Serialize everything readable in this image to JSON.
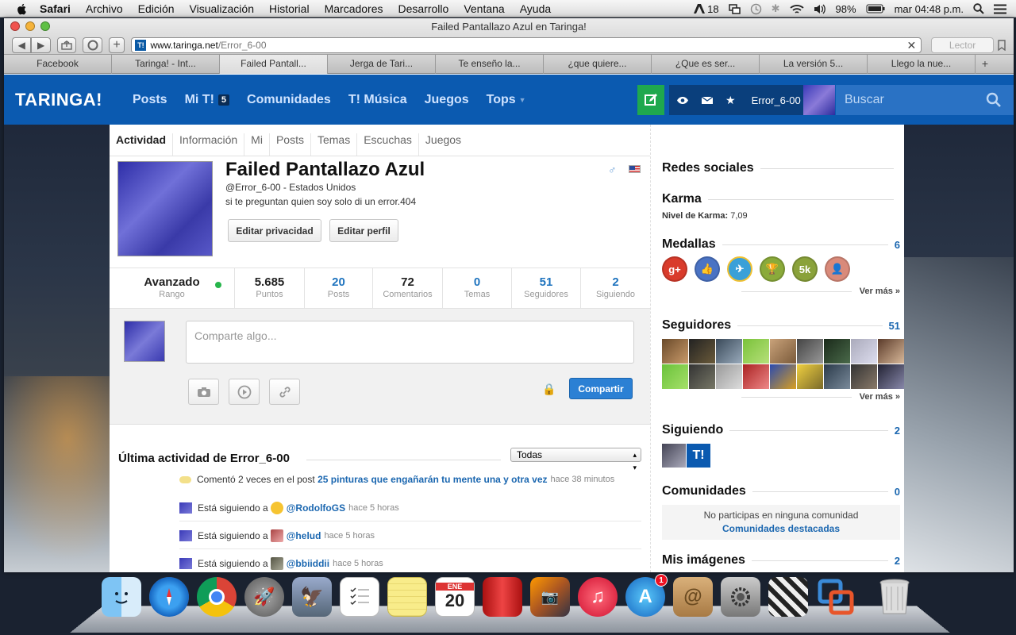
{
  "menubar": {
    "app": "Safari",
    "items": [
      "Archivo",
      "Edición",
      "Visualización",
      "Historial",
      "Marcadores",
      "Desarrollo",
      "Ventana",
      "Ayuda"
    ],
    "status": {
      "adobe": "18",
      "battery": "98%",
      "clock": "mar 04:48 p.m."
    }
  },
  "window": {
    "title": "Failed Pantallazo Azul en Taringa!",
    "url_host": "www.taringa.net",
    "url_path": "/Error_6-00",
    "reader": "Lector",
    "tabs": [
      "Facebook",
      "Taringa! - Int...",
      "Failed Pantall...",
      "Jerga de Tari...",
      "Te enseño la...",
      "¿que quiere...",
      "¿Que es ser...",
      "La versión 5...",
      "Llego la nue..."
    ]
  },
  "site": {
    "logo": "TARINGA!",
    "nav": [
      {
        "label": "Posts"
      },
      {
        "label": "Mi T!",
        "badge": "5"
      },
      {
        "label": "Comunidades"
      },
      {
        "label": "T! Música"
      },
      {
        "label": "Juegos"
      },
      {
        "label": "Tops"
      }
    ],
    "username": "Error_6-00",
    "search_placeholder": "Buscar"
  },
  "profile": {
    "tabs": [
      "Actividad",
      "Información",
      "Mi",
      "Posts",
      "Temas",
      "Escuchas",
      "Juegos"
    ],
    "name": "Failed Pantallazo Azul",
    "handle": "@Error_6-00 - Estados Unidos",
    "bio": "si te preguntan quien soy solo di un error.404",
    "btn_privacy": "Editar privacidad",
    "btn_edit": "Editar perfil",
    "stats": [
      {
        "value": "Avanzado",
        "label": "Rango"
      },
      {
        "value": "5.685",
        "label": "Puntos"
      },
      {
        "value": "20",
        "label": "Posts"
      },
      {
        "value": "72",
        "label": "Comentarios"
      },
      {
        "value": "0",
        "label": "Temas"
      },
      {
        "value": "51",
        "label": "Seguidores"
      },
      {
        "value": "2",
        "label": "Siguiendo"
      }
    ],
    "composer_placeholder": "Comparte algo...",
    "share_button": "Compartir"
  },
  "activity": {
    "title": "Última actividad de Error_6-00",
    "filter": "Todas",
    "rows": [
      {
        "pre": "Comentó 2 veces en el post",
        "link": "25 pinturas que engañarán tu mente una y otra vez",
        "time": "hace 38 minutos"
      },
      {
        "pre": "Está siguiendo a",
        "link": "@RodolfoGS",
        "time": "hace 5 horas"
      },
      {
        "pre": "Está siguiendo a",
        "link": "@helud",
        "time": "hace 5 horas"
      },
      {
        "pre": "Está siguiendo a",
        "link": "@bbiiddii",
        "time": "hace 5 horas"
      }
    ]
  },
  "sidebar": {
    "social": "Redes sociales",
    "karma_title": "Karma",
    "karma_label": "Nivel de Karma:",
    "karma_value": "7,09",
    "medals_title": "Medallas",
    "medals_count": "6",
    "medals": [
      {
        "text": "g+",
        "color": "#d93b2b"
      },
      {
        "text": "👍",
        "color": "#4a73c4"
      },
      {
        "text": "✈",
        "color": "#3aa0d8"
      },
      {
        "text": "🏆",
        "color": "#8aaa3a"
      },
      {
        "text": "5k",
        "color": "#8aa23a"
      },
      {
        "text": "👤",
        "color": "#d98a7a"
      }
    ],
    "more": "Ver más »",
    "followers_title": "Seguidores",
    "followers_count": "51",
    "following_title": "Siguiendo",
    "following_count": "2",
    "communities_title": "Comunidades",
    "communities_count": "0",
    "communities_empty": "No participas en ninguna comunidad",
    "communities_link": "Comunidades destacadas",
    "images_title": "Mis imágenes",
    "images_count": "2"
  },
  "dock": {
    "calendar_month": "ENE",
    "calendar_day": "20",
    "appstore_badge": "1"
  }
}
